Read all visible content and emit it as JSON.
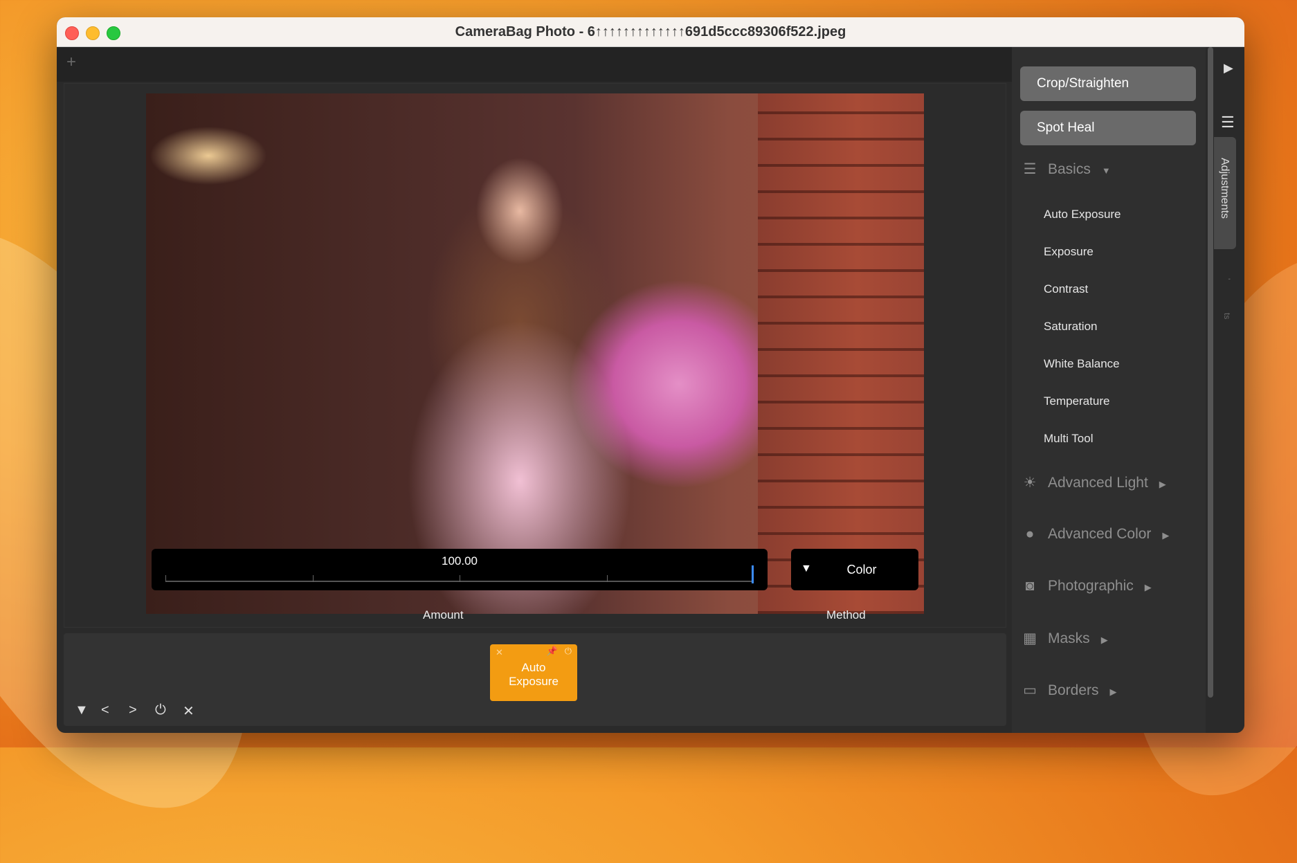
{
  "window": {
    "title": "CameraBag Photo - 6↑↑↑↑↑↑↑↑↑↑↑↑↑691d5ccc89306f522.jpeg"
  },
  "topbar": {
    "add_tab": "+"
  },
  "slider": {
    "value": "100.00",
    "label": "Amount"
  },
  "method": {
    "arrow": "▼",
    "value": "Color",
    "label": "Method"
  },
  "tray": {
    "chip": {
      "close": "✕",
      "pin": "📌",
      "power": "⏻",
      "label_line1": "Auto",
      "label_line2": "Exposure"
    },
    "nav": {
      "collapse": "▼",
      "prev": "<",
      "next": ">",
      "power": "⏻",
      "close": "✕"
    }
  },
  "sidebar": {
    "tools": [
      "Crop/Straighten",
      "Spot Heal"
    ],
    "sections": [
      {
        "label": "Basics",
        "icon": "sliders-icon",
        "glyph": "☰",
        "arrow": "▼"
      },
      {
        "label": "Advanced Light",
        "icon": "sun-icon",
        "glyph": "☀",
        "arrow": "▶"
      },
      {
        "label": "Advanced Color",
        "icon": "color-circles-icon",
        "glyph": "●",
        "arrow": "▶"
      },
      {
        "label": "Photographic",
        "icon": "camera-icon",
        "glyph": "◙",
        "arrow": "▶"
      },
      {
        "label": "Masks",
        "icon": "checker-icon",
        "glyph": "▦",
        "arrow": "▶"
      },
      {
        "label": "Borders",
        "icon": "border-icon",
        "glyph": "▭",
        "arrow": "▶"
      }
    ],
    "basics_items": [
      "Auto Exposure",
      "Exposure",
      "Contrast",
      "Saturation",
      "White Balance",
      "Temperature",
      "Multi Tool"
    ]
  },
  "side_strip": {
    "play": "▶",
    "menu": "☰",
    "tab_label": "Adjustments",
    "small1": "'",
    "small2": "ts"
  }
}
